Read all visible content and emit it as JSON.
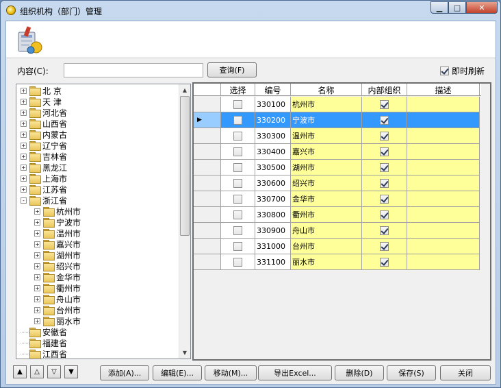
{
  "window": {
    "title": "组织机构（部门）管理",
    "min_glyph": "▁",
    "max_glyph": "□",
    "close_glyph": "✕"
  },
  "search": {
    "label": "内容(C):",
    "value": "",
    "button": "查询(F)",
    "auto_refresh_label": "即时刷新",
    "auto_refresh_checked": true
  },
  "tree": {
    "nodes": [
      {
        "label": "北 京",
        "level": 0,
        "expand": "+"
      },
      {
        "label": "天 津",
        "level": 0,
        "expand": "+"
      },
      {
        "label": "河北省",
        "level": 0,
        "expand": "+"
      },
      {
        "label": "山西省",
        "level": 0,
        "expand": "+"
      },
      {
        "label": "内蒙古",
        "level": 0,
        "expand": "+"
      },
      {
        "label": "辽宁省",
        "level": 0,
        "expand": "+"
      },
      {
        "label": "吉林省",
        "level": 0,
        "expand": "+"
      },
      {
        "label": "黑龙江",
        "level": 0,
        "expand": "+"
      },
      {
        "label": "上海市",
        "level": 0,
        "expand": "+"
      },
      {
        "label": "江苏省",
        "level": 0,
        "expand": "+"
      },
      {
        "label": "浙江省",
        "level": 0,
        "expand": "-"
      },
      {
        "label": "杭州市",
        "level": 1,
        "expand": "+"
      },
      {
        "label": "宁波市",
        "level": 1,
        "expand": "+"
      },
      {
        "label": "温州市",
        "level": 1,
        "expand": "+"
      },
      {
        "label": "嘉兴市",
        "level": 1,
        "expand": "+"
      },
      {
        "label": "湖州市",
        "level": 1,
        "expand": "+"
      },
      {
        "label": "绍兴市",
        "level": 1,
        "expand": "+"
      },
      {
        "label": "金华市",
        "level": 1,
        "expand": "+"
      },
      {
        "label": "衢州市",
        "level": 1,
        "expand": "+"
      },
      {
        "label": "舟山市",
        "level": 1,
        "expand": "+"
      },
      {
        "label": "台州市",
        "level": 1,
        "expand": "+"
      },
      {
        "label": "丽水市",
        "level": 1,
        "expand": "+"
      },
      {
        "label": "安徽省",
        "level": 0,
        "expand": ""
      },
      {
        "label": "福建省",
        "level": 0,
        "expand": ""
      },
      {
        "label": "江西省",
        "level": 0,
        "expand": ""
      }
    ]
  },
  "grid": {
    "columns": [
      "选择",
      "编号",
      "名称",
      "内部组织",
      "描述"
    ],
    "selected_row": 1,
    "rows": [
      {
        "selected": false,
        "code": "330100",
        "name": "杭州市",
        "internal": true,
        "desc": ""
      },
      {
        "selected": false,
        "code": "330200",
        "name": "宁波市",
        "internal": true,
        "desc": ""
      },
      {
        "selected": false,
        "code": "330300",
        "name": "温州市",
        "internal": true,
        "desc": ""
      },
      {
        "selected": false,
        "code": "330400",
        "name": "嘉兴市",
        "internal": true,
        "desc": ""
      },
      {
        "selected": false,
        "code": "330500",
        "name": "湖州市",
        "internal": true,
        "desc": ""
      },
      {
        "selected": false,
        "code": "330600",
        "name": "绍兴市",
        "internal": true,
        "desc": ""
      },
      {
        "selected": false,
        "code": "330700",
        "name": "金华市",
        "internal": true,
        "desc": ""
      },
      {
        "selected": false,
        "code": "330800",
        "name": "衢州市",
        "internal": true,
        "desc": ""
      },
      {
        "selected": false,
        "code": "330900",
        "name": "舟山市",
        "internal": true,
        "desc": ""
      },
      {
        "selected": false,
        "code": "331000",
        "name": "台州市",
        "internal": true,
        "desc": ""
      },
      {
        "selected": false,
        "code": "331100",
        "name": "丽水市",
        "internal": true,
        "desc": ""
      }
    ]
  },
  "nav_buttons": [
    "▲",
    "△",
    "▽",
    "▼"
  ],
  "actions": {
    "add": "添加(A)...",
    "edit": "编辑(E)...",
    "move": "移动(M)...",
    "export": "导出Excel...",
    "delete": "删除(D)",
    "save": "保存(S)",
    "close": "关闭"
  },
  "colors": {
    "name_cell": "#ffff99",
    "selected_row": "#3399ff",
    "row_indicator": "#99ccff",
    "grid_bg": "#f0f0f0"
  }
}
